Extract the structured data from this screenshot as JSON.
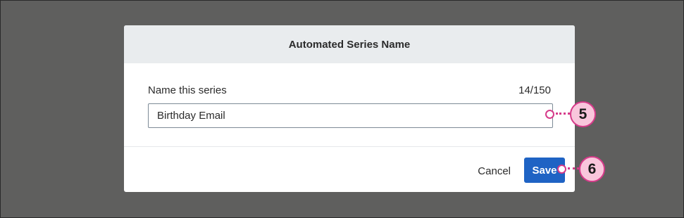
{
  "dialog": {
    "title": "Automated Series Name",
    "field_label": "Name this series",
    "char_count": "14/150",
    "input_value": "Birthday Email",
    "cancel_label": "Cancel",
    "save_label": "Save"
  },
  "callouts": [
    {
      "number": "5"
    },
    {
      "number": "6"
    }
  ],
  "colors": {
    "backdrop": "#5f5f5e",
    "header_bg": "#e9ecee",
    "primary": "#1f63c4",
    "callout_stroke": "#d63b8a",
    "callout_fill": "#f9c6dc"
  }
}
